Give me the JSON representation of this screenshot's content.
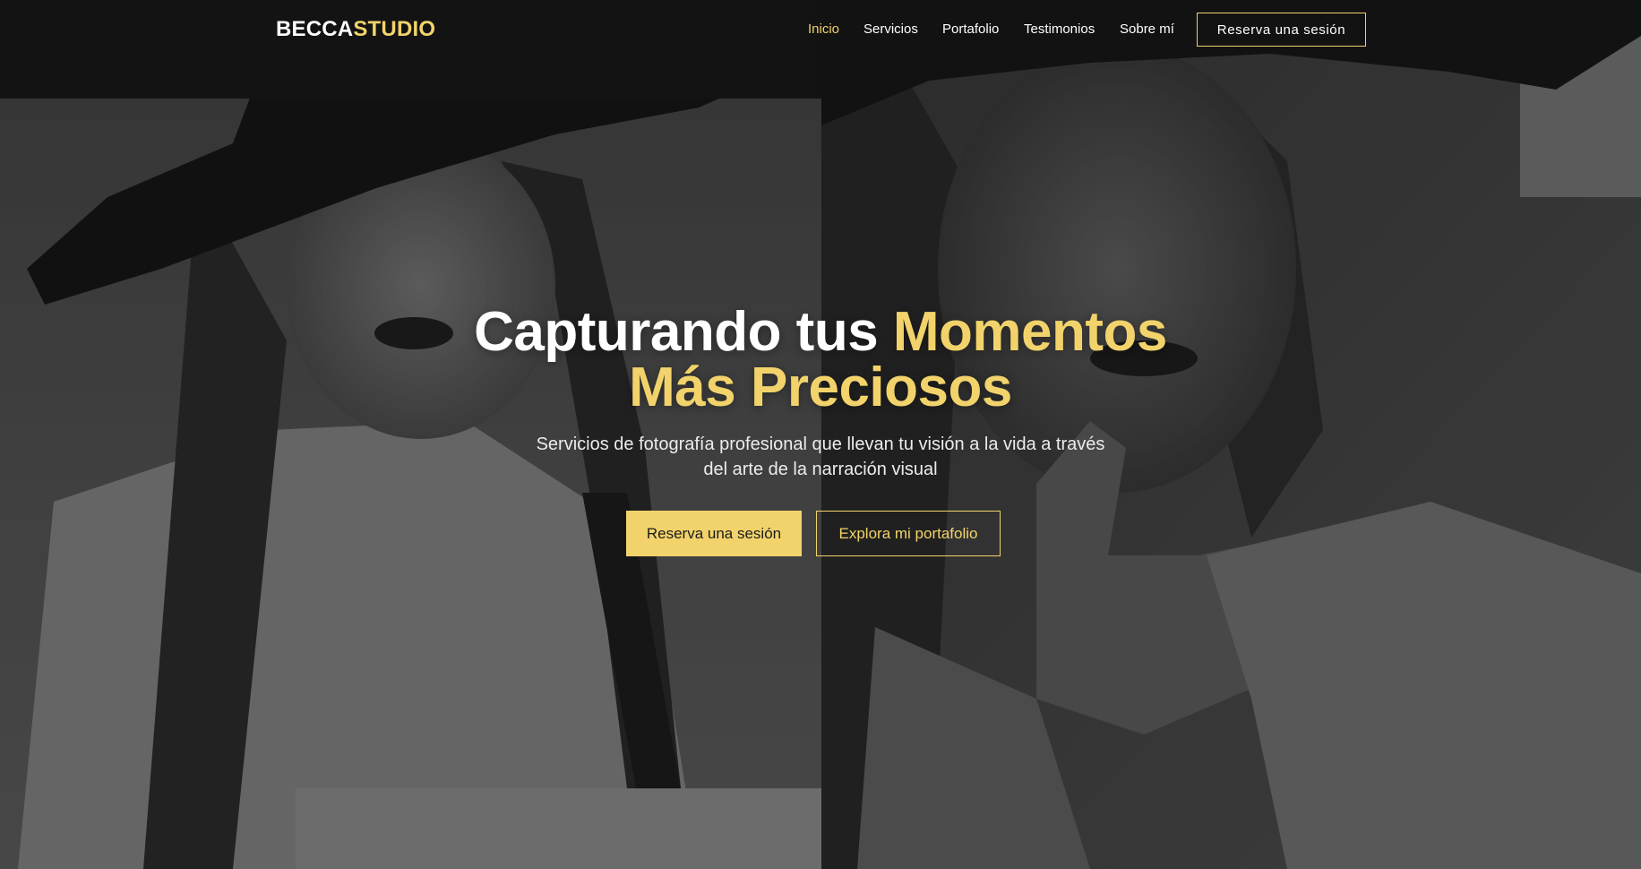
{
  "brand": {
    "name_part1": "BECCA",
    "name_part2": "STUDIO"
  },
  "nav": {
    "links": [
      {
        "label": "Inicio",
        "active": true
      },
      {
        "label": "Servicios",
        "active": false
      },
      {
        "label": "Portafolio",
        "active": false
      },
      {
        "label": "Testimonios",
        "active": false
      },
      {
        "label": "Sobre mí",
        "active": false
      }
    ],
    "cta_label": "Reserva una sesión"
  },
  "hero": {
    "headline_plain": "Capturando tus ",
    "headline_accent_line1": "Momentos",
    "headline_accent_line2": "Más Preciosos",
    "subtitle": "Servicios de fotografía profesional que llevan tu visión a la vida a través del arte de la narración visual",
    "primary_button": "Reserva una sesión",
    "secondary_button": "Explora mi portafolio",
    "background_images": [
      "portrait-woman-hat",
      "portrait-woman-finger-lips"
    ]
  },
  "colors": {
    "accent": "#f2d36b",
    "text": "#ffffff",
    "overlay": "#0f0f0f"
  }
}
